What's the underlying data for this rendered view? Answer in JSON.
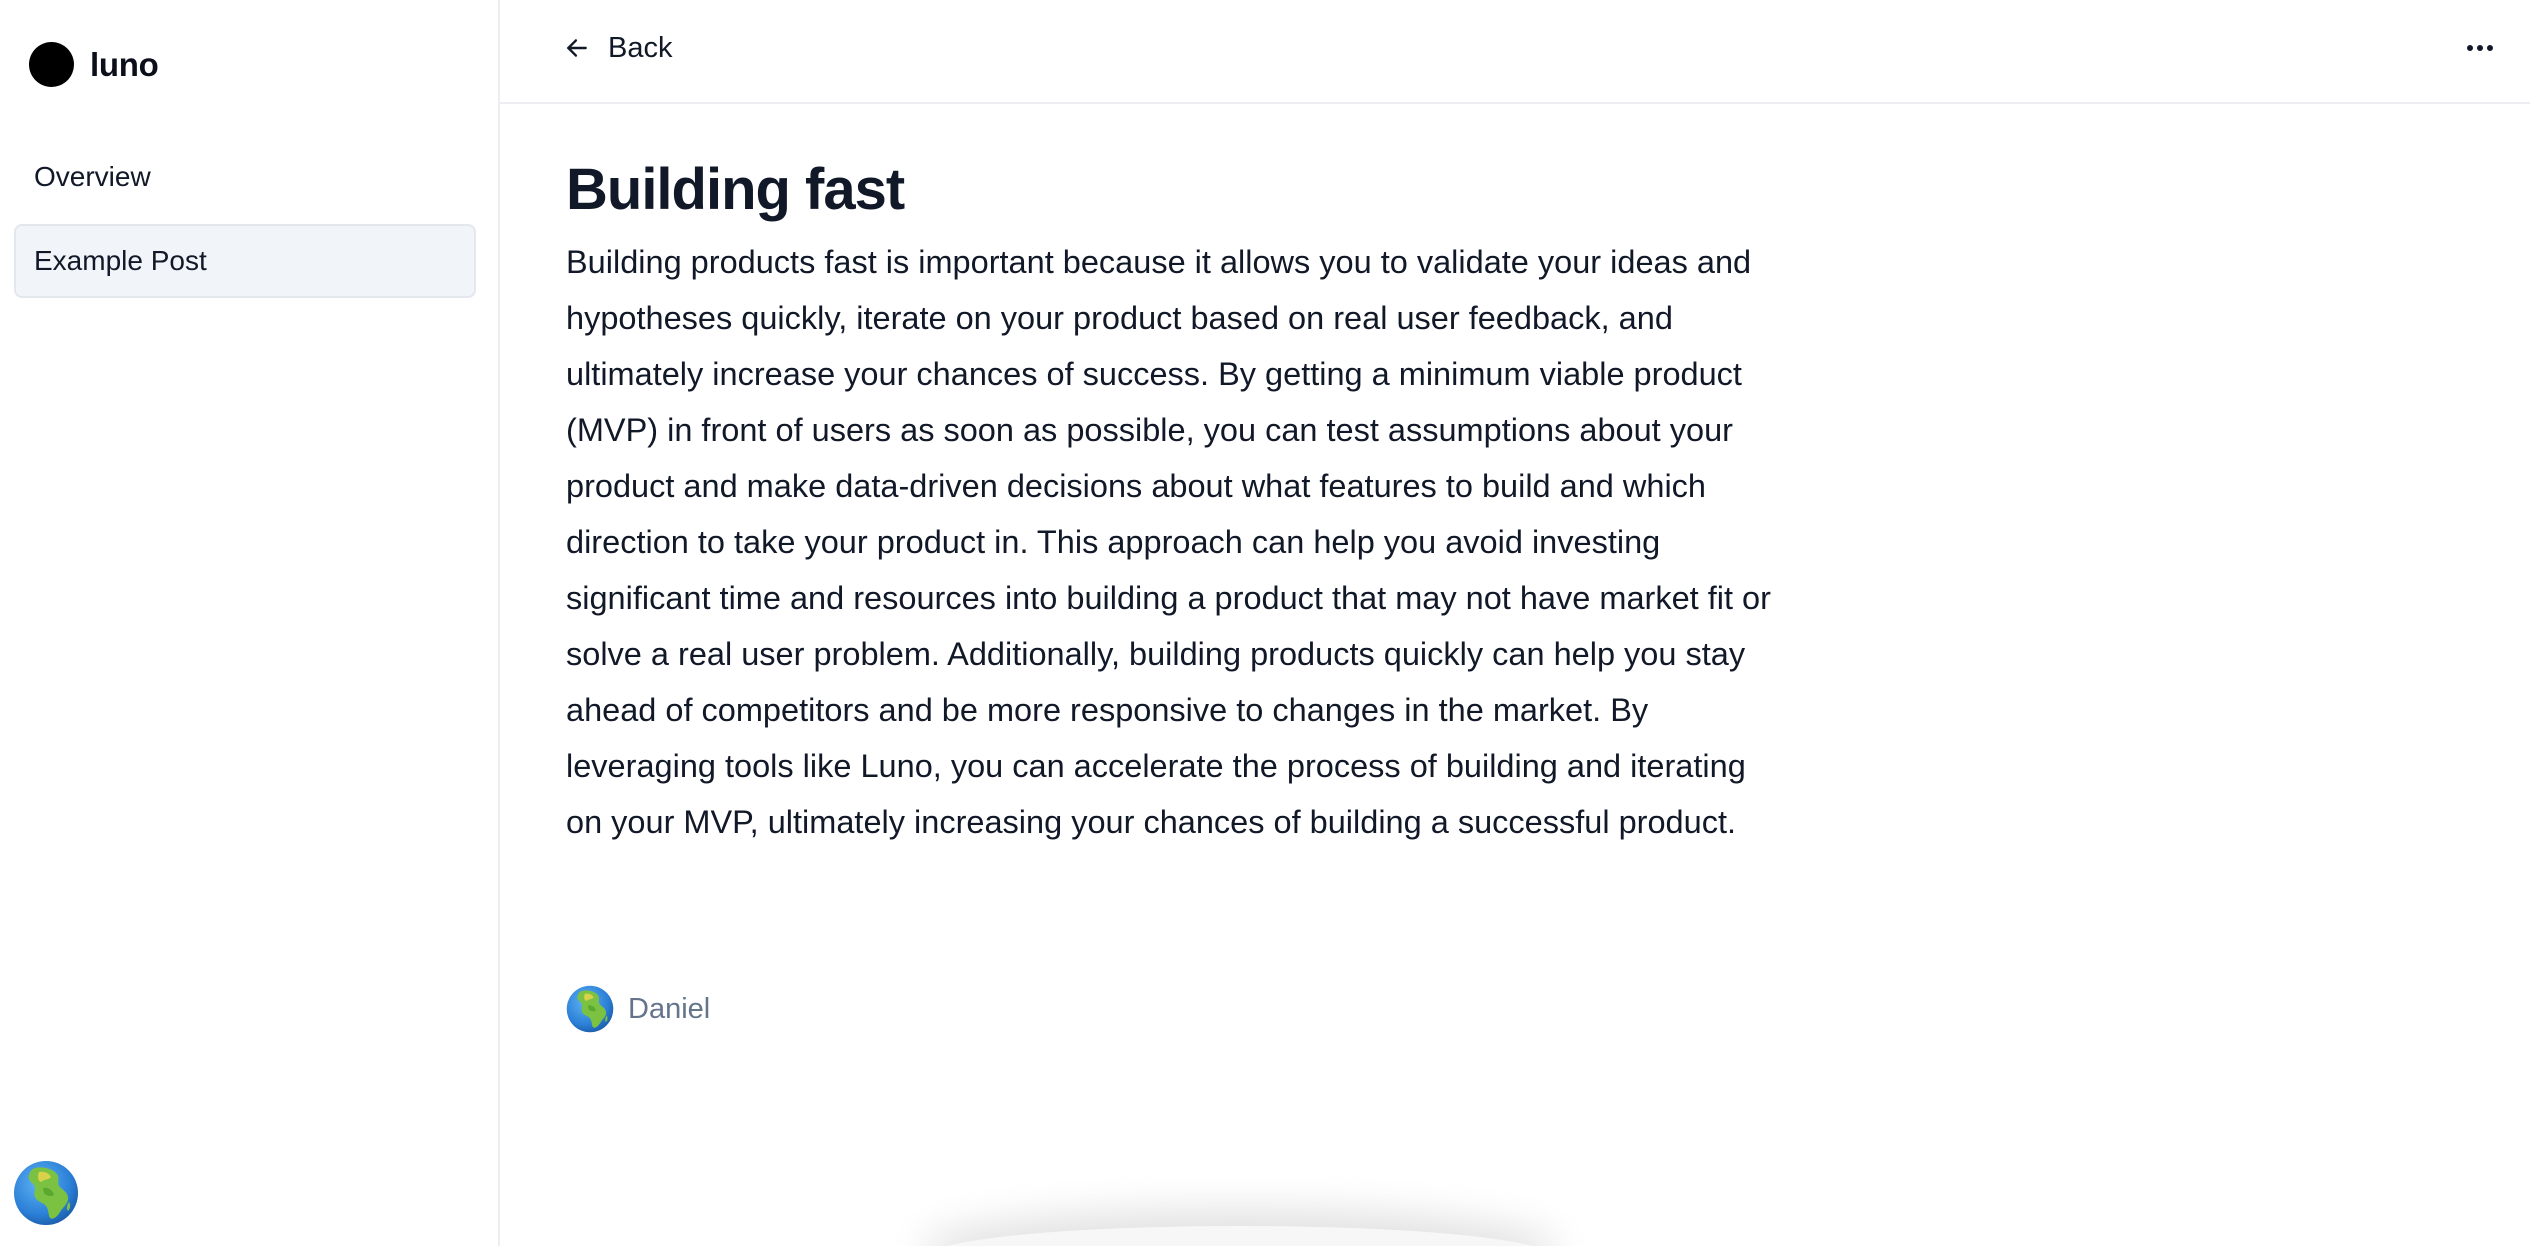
{
  "brand": {
    "name": "luno"
  },
  "sidebar": {
    "items": [
      {
        "label": "Overview",
        "active": false
      },
      {
        "label": "Example Post",
        "active": true
      }
    ],
    "user_avatar_icon": "globe-africa-icon"
  },
  "topbar": {
    "back_label": "Back",
    "back_icon": "arrow-left-icon",
    "more_icon": "more-horizontal-icon"
  },
  "post": {
    "title": "Building fast",
    "body": "Building products fast is important because it allows you to validate your ideas and hypotheses quickly, iterate on your product based on real user feedback, and ultimately increase your chances of success. By getting a minimum viable product (MVP) in front of users as soon as possible, you can test assumptions about your product and make data-driven decisions about what features to build and which direction to take your product in. This approach can help you avoid investing significant time and resources into building a product that may not have market fit or solve a real user problem. Additionally, building products quickly can help you stay ahead of competitors and be more responsive to changes in the market. By leveraging tools like Luno, you can accelerate the process of building and iterating on your MVP, ultimately increasing your chances of building a successful product.",
    "author": {
      "name": "Daniel",
      "avatar_icon": "globe-africa-icon"
    }
  },
  "colors": {
    "text_primary": "#111827",
    "text_muted": "#64748b",
    "nav_active_bg": "#f1f4f8",
    "border": "#eceef2"
  }
}
